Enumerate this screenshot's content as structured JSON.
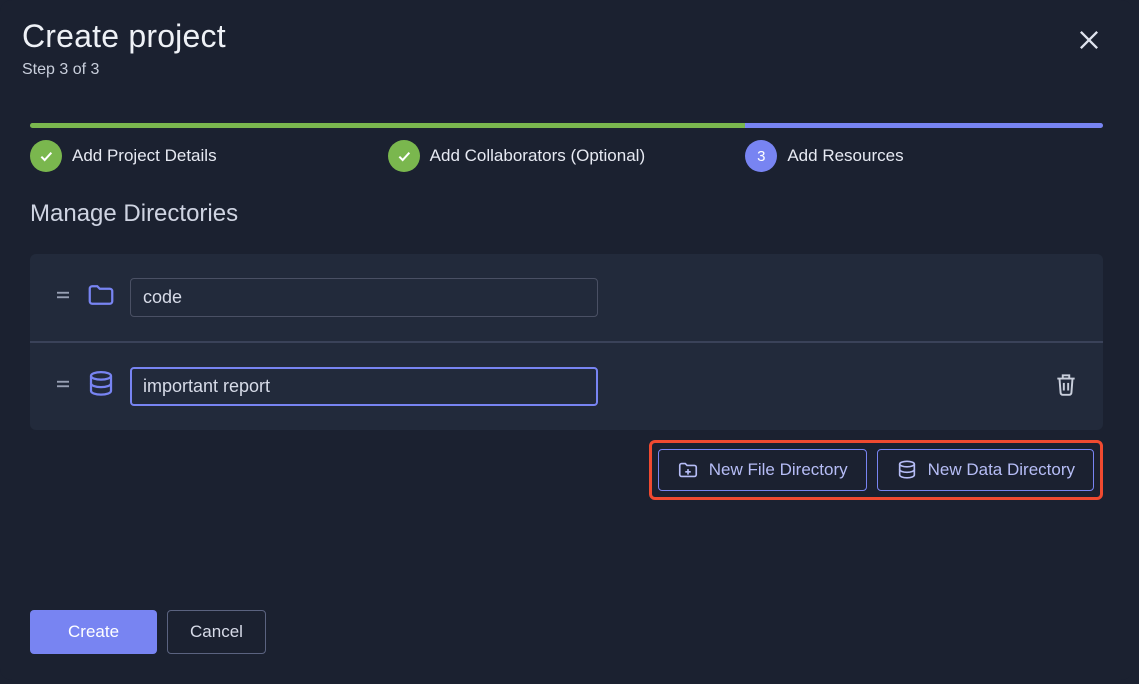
{
  "header": {
    "title": "Create project",
    "subtitle": "Step 3 of 3"
  },
  "stepper": {
    "progress": {
      "greenPct": 66.6,
      "bluePct": 33.4
    },
    "steps": [
      {
        "label": "Add Project Details",
        "state": "done"
      },
      {
        "label": "Add Collaborators (Optional)",
        "state": "done"
      },
      {
        "label": "Add Resources",
        "state": "active",
        "number": "3"
      }
    ]
  },
  "section_title": "Manage Directories",
  "directories": [
    {
      "kind": "file",
      "value": "code",
      "deletable": false,
      "focused": false
    },
    {
      "kind": "data",
      "value": "important report",
      "deletable": true,
      "focused": true
    }
  ],
  "actions": {
    "new_file_dir": "New File Directory",
    "new_data_dir": "New Data Directory"
  },
  "footer": {
    "create": "Create",
    "cancel": "Cancel"
  },
  "colors": {
    "accent": "#7884f2",
    "success": "#7ab74e",
    "highlight_box": "#f04a30"
  }
}
